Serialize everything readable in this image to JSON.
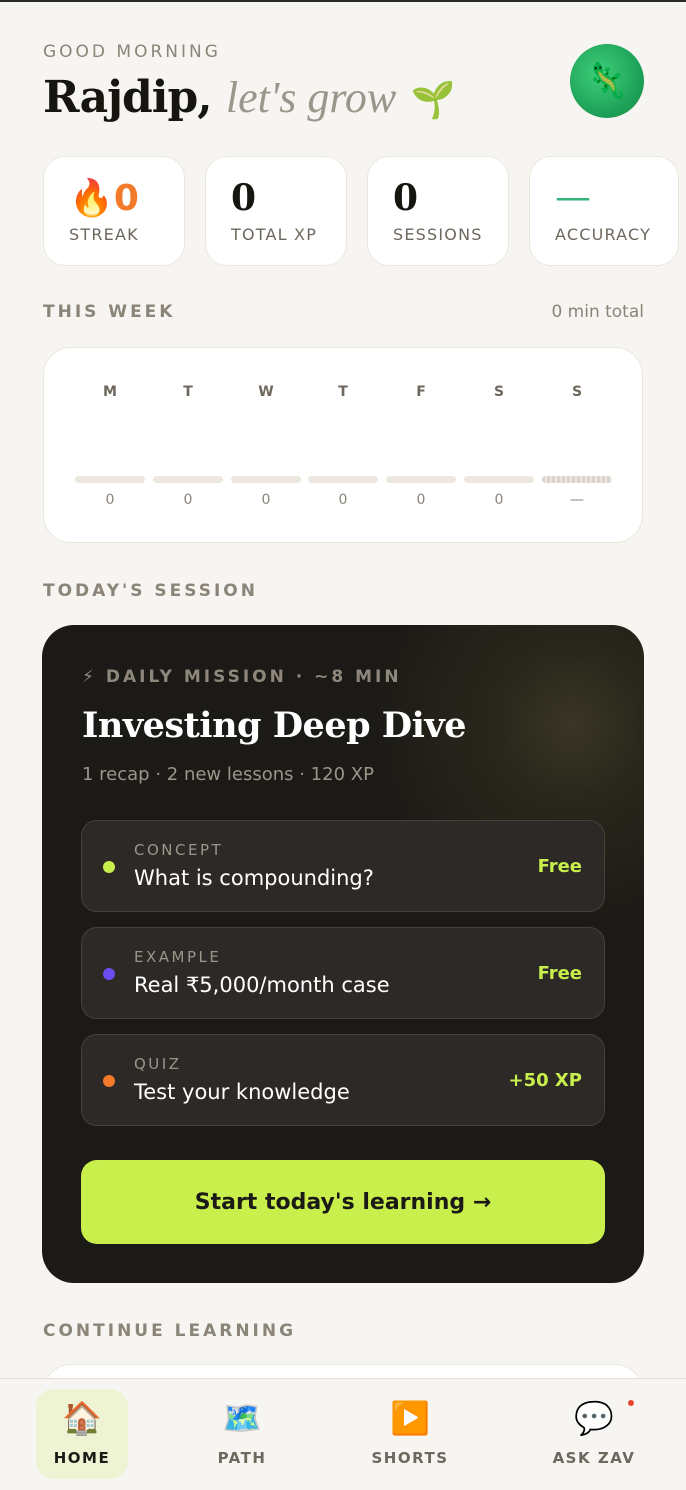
{
  "header": {
    "greeting": "GOOD MORNING",
    "name": "Rajdip,",
    "tagline": "let's grow",
    "sprout": "🌱",
    "avatar_icon": "🦎"
  },
  "stats": [
    {
      "icon": "🔥",
      "value": "0",
      "label": "STREAK"
    },
    {
      "value": "0",
      "label": "TOTAL XP"
    },
    {
      "value": "0",
      "label": "SESSIONS"
    },
    {
      "value": "—",
      "label": "ACCURACY"
    }
  ],
  "week": {
    "label": "THIS WEEK",
    "total": "0 min total",
    "days": [
      {
        "day": "M",
        "value": "0"
      },
      {
        "day": "T",
        "value": "0"
      },
      {
        "day": "W",
        "value": "0"
      },
      {
        "day": "T",
        "value": "0"
      },
      {
        "day": "F",
        "value": "0"
      },
      {
        "day": "S",
        "value": "0"
      },
      {
        "day": "S",
        "value": "—"
      }
    ]
  },
  "session": {
    "section_label": "TODAY'S SESSION",
    "mission_label": "⚡ DAILY MISSION · ~8 MIN",
    "title": "Investing Deep Dive",
    "meta": "1 recap · 2 new lessons · 120 XP",
    "lessons": [
      {
        "kind": "CONCEPT",
        "name": "What is compounding?",
        "tag": "Free",
        "dot_color": "#c8ef4c"
      },
      {
        "kind": "EXAMPLE",
        "name": "Real ₹5,000/month case",
        "tag": "Free",
        "dot_color": "#6c4cf0"
      },
      {
        "kind": "QUIZ",
        "name": "Test your knowledge",
        "tag": "+50 XP",
        "dot_color": "#f27b2b"
      }
    ],
    "cta": "Start today's learning →"
  },
  "continue": {
    "label": "CONTINUE LEARNING"
  },
  "tabs": [
    {
      "icon": "🏠",
      "label": "HOME",
      "active": true
    },
    {
      "icon": "🗺️",
      "label": "PATH"
    },
    {
      "icon": "▶️",
      "label": "SHORTS"
    },
    {
      "icon": "💬",
      "label": "ASK ZAV"
    }
  ],
  "colors": {
    "accent": "#c8ef4c",
    "background": "#f7f5f1",
    "card_dark": "#1c1a16",
    "streak": "#f27b2b"
  }
}
